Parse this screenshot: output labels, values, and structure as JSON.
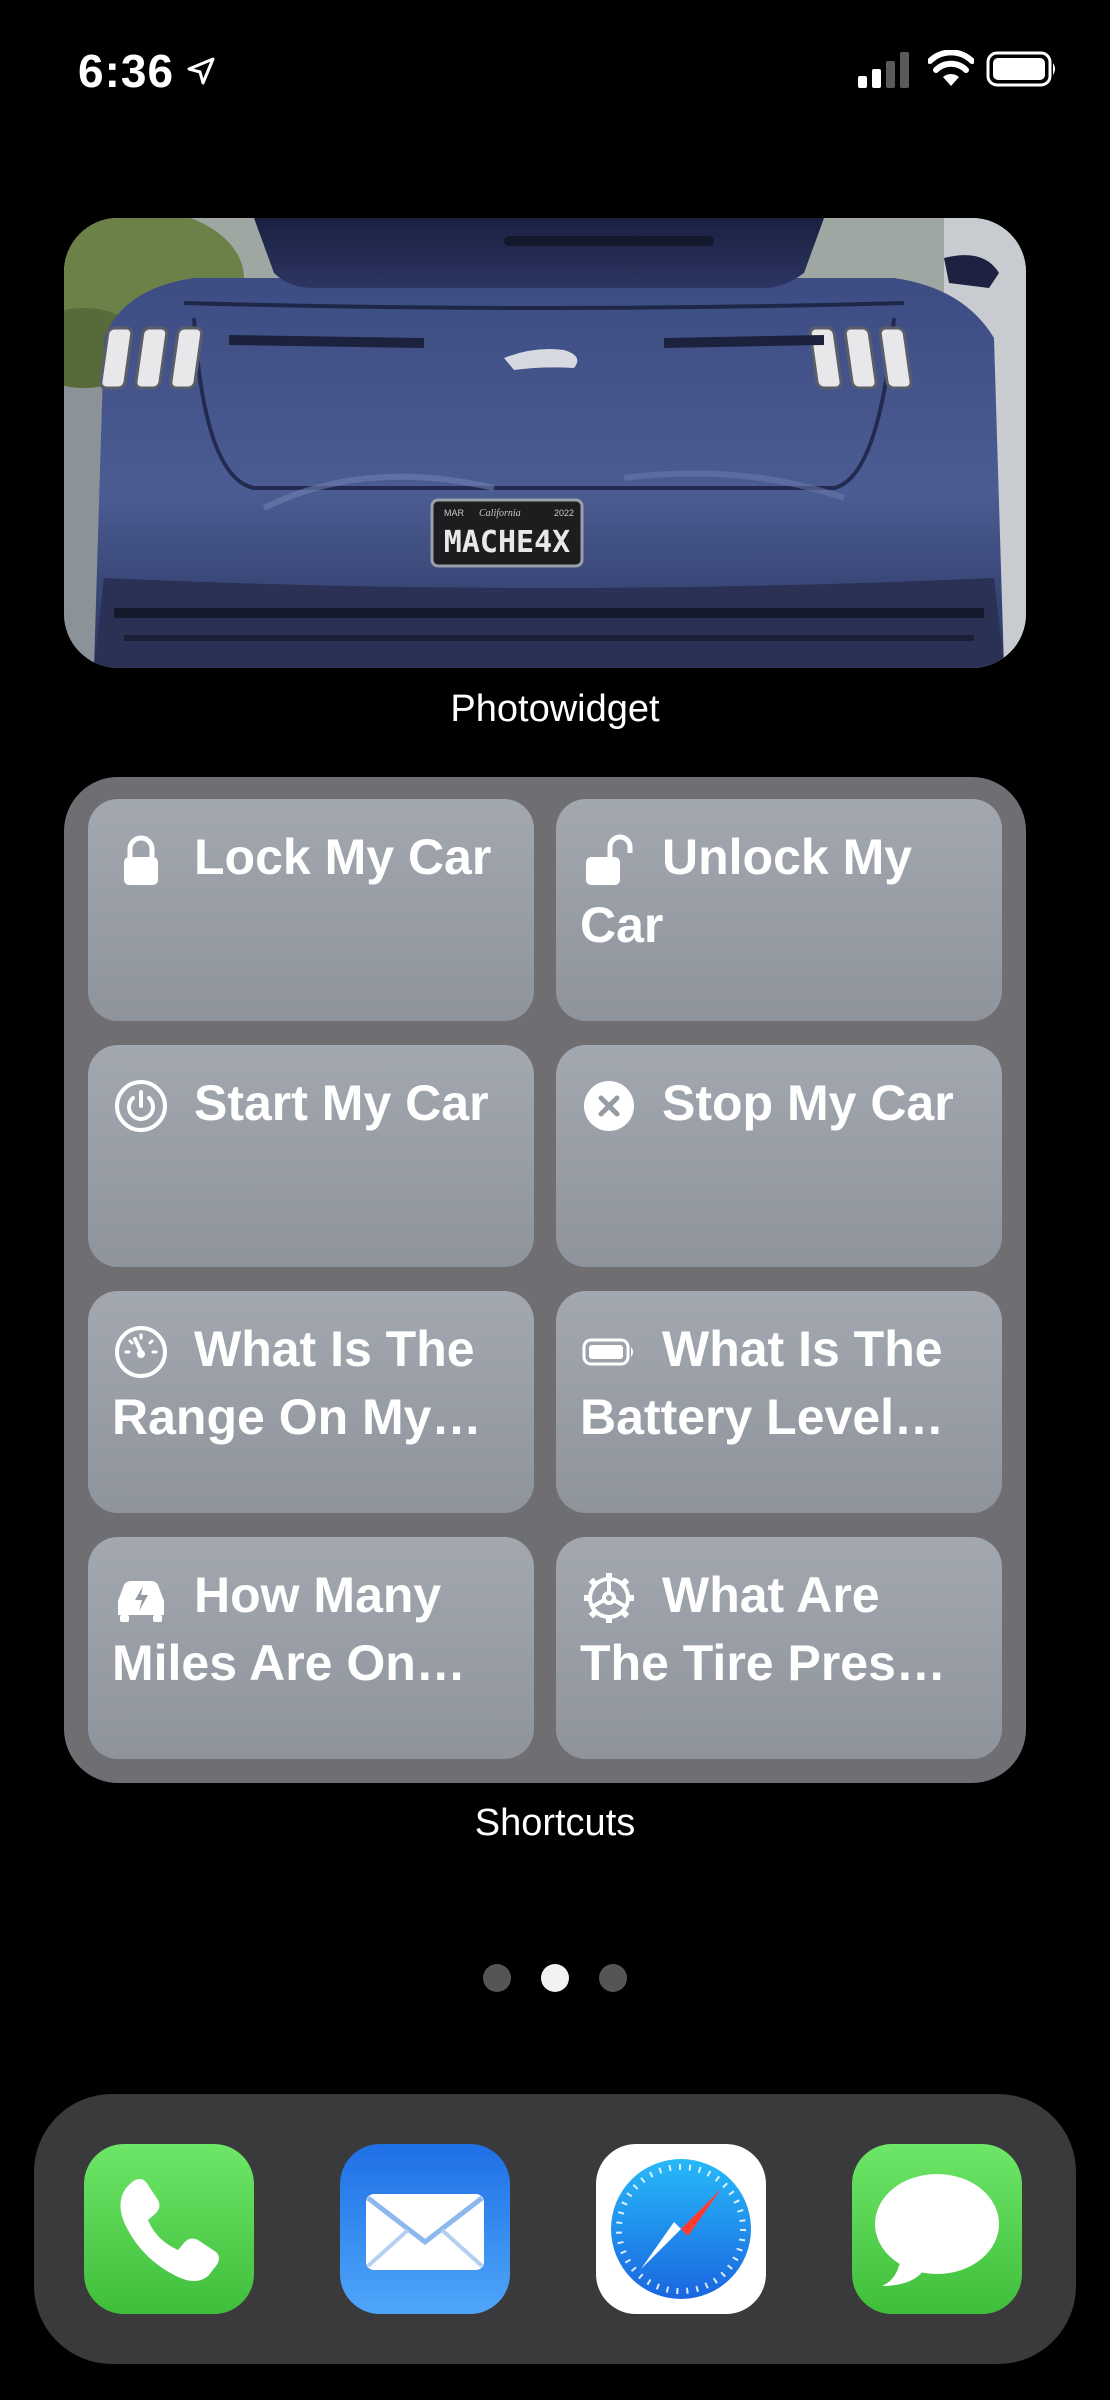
{
  "status_bar": {
    "time": "6:36",
    "icons": [
      "location-arrow-icon",
      "cellular-signal-icon",
      "wifi-icon",
      "battery-icon"
    ]
  },
  "photo_widget": {
    "caption": "Photowidget",
    "photo": {
      "subject": "rear view of blue Mustang Mach-E",
      "plate_text": "MACHE4X",
      "plate_header": "California",
      "plate_month": "MAR",
      "plate_year": "2022"
    }
  },
  "shortcuts_widget": {
    "caption": "Shortcuts",
    "tiles": [
      {
        "label": "Lock My Car",
        "icon": "lock-icon"
      },
      {
        "label": "Unlock My Car",
        "icon": "unlock-icon"
      },
      {
        "label": "Start My Car",
        "icon": "power-icon"
      },
      {
        "label": "Stop My Car",
        "icon": "close-circle-icon"
      },
      {
        "label": "What Is The Range On My…",
        "icon": "speedometer-icon"
      },
      {
        "label": "What Is The Battery Level…",
        "icon": "battery-icon"
      },
      {
        "label": "How Many Miles Are On…",
        "icon": "car-icon"
      },
      {
        "label": "What Are The Tire Pres…",
        "icon": "wheel-icon"
      }
    ]
  },
  "page_indicator": {
    "count": 3,
    "active": 2
  },
  "dock": {
    "apps": [
      {
        "name": "Phone",
        "icon": "phone-icon",
        "color": "#5fd55a"
      },
      {
        "name": "Mail",
        "icon": "mail-icon",
        "color": "#2f88f5"
      },
      {
        "name": "Safari",
        "icon": "compass-icon",
        "color": "#1a8cf0"
      },
      {
        "name": "Messages",
        "icon": "message-bubble-icon",
        "color": "#5fd55a"
      }
    ]
  }
}
